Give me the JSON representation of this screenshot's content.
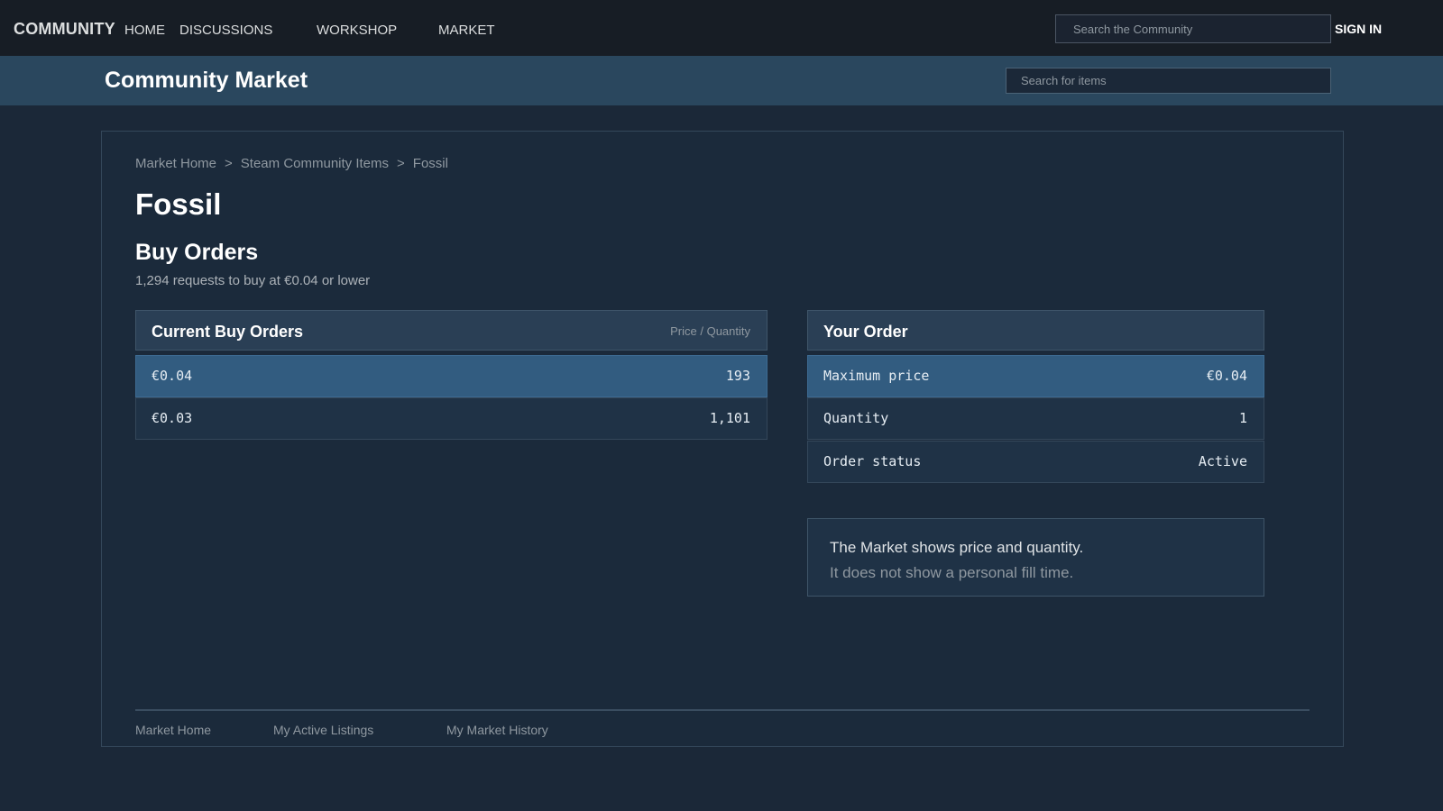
{
  "topnav": {
    "brand": "COMMUNITY",
    "links": [
      "HOME",
      "DISCUSSIONS",
      "WORKSHOP",
      "MARKET"
    ],
    "search_placeholder": "Search the Community",
    "sign_in": "SIGN IN"
  },
  "subheader": {
    "title": "Community Market",
    "search_placeholder": "Search for items"
  },
  "breadcrumb": {
    "items": [
      "Market Home",
      "Steam Community Items",
      "Fossil"
    ],
    "separator": ">"
  },
  "item": {
    "name": "Fossil"
  },
  "buy_orders": {
    "title": "Buy Orders",
    "summary": "1,294 requests to buy at €0.04 or lower",
    "table": {
      "title": "Current Buy Orders",
      "header_right": "Price / Quantity",
      "rows": [
        {
          "price": "€0.04",
          "quantity": "193"
        },
        {
          "price": "€0.03",
          "quantity": "1,101"
        }
      ]
    }
  },
  "your_order": {
    "title": "Your Order",
    "rows": [
      {
        "label": "Maximum price",
        "value": "€0.04"
      },
      {
        "label": "Quantity",
        "value": "1"
      },
      {
        "label": "Order status",
        "value": "Active"
      }
    ]
  },
  "note": {
    "line1": "The Market shows price and quantity.",
    "line2": "It does not show a personal fill time."
  },
  "footer": {
    "links": [
      "Market Home",
      "My Active Listings",
      "My Market History"
    ]
  },
  "colors": {
    "page_bg": "#1b2838",
    "topnav_bg": "#171d25",
    "subheader_bg": "#2a475e",
    "highlight_row": "#325c80"
  }
}
